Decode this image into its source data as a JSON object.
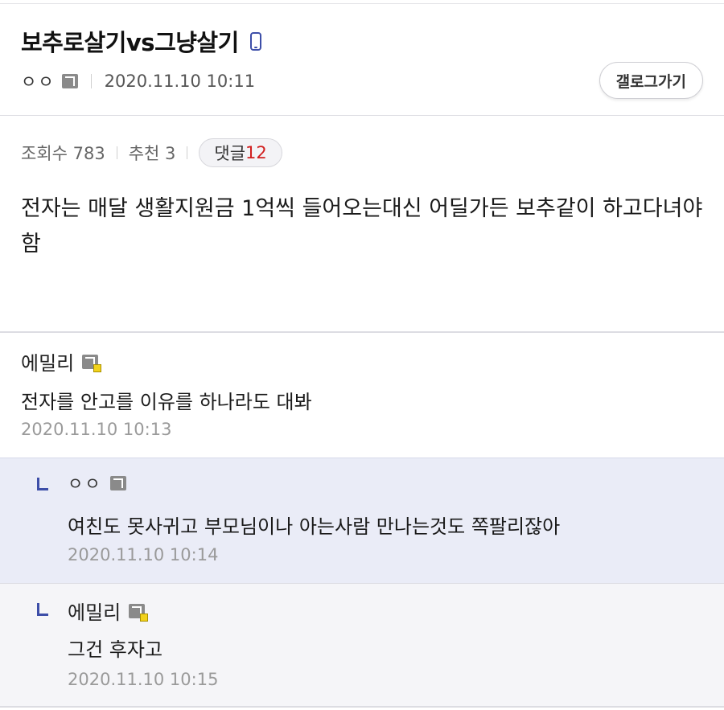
{
  "post": {
    "title": "보추로살기vs그냥살기",
    "author": "ㅇㅇ",
    "date": "2020.11.10 10:11",
    "gallery_button": "갤로그가기",
    "views_label": "조회수 783",
    "recommend_label": "추천 3",
    "comments_label": "댓글",
    "comments_count": "12",
    "body": "전자는 매달 생활지원금 1억씩 들어오는대신 어딜가든 보추같이 하고다녀야함"
  },
  "comments": [
    {
      "author": "에밀리",
      "text": "전자를 안고를 이유를 하나라도 대봐",
      "date": "2020.11.10 10:13"
    },
    {
      "author": "ㅇㅇ",
      "text": "여친도 못사귀고 부모님이나 아는사람 만나는것도 쪽팔리잖아",
      "date": "2020.11.10 10:14"
    },
    {
      "author": "에밀리",
      "text": "그건 후자고",
      "date": "2020.11.10 10:15"
    }
  ],
  "colors": {
    "accent": "#3d4ea8",
    "comment_count": "#d11f1f",
    "reply_bg": "#eaecf7"
  },
  "icons": [
    "phone-icon",
    "gallery-user-icon",
    "reply-arrow-icon"
  ]
}
